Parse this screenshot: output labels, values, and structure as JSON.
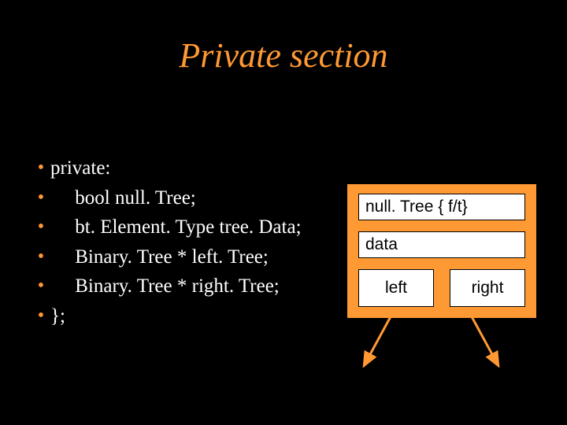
{
  "title": "Private section",
  "bullets": [
    "private:",
    "     bool null. Tree;",
    "     bt. Element. Type tree. Data;",
    "     Binary. Tree * left. Tree;",
    "     Binary. Tree * right. Tree;",
    "};"
  ],
  "diagram": {
    "null_label": "null. Tree { f/t}",
    "data_label": "data",
    "left_label": "left",
    "right_label": "right"
  }
}
